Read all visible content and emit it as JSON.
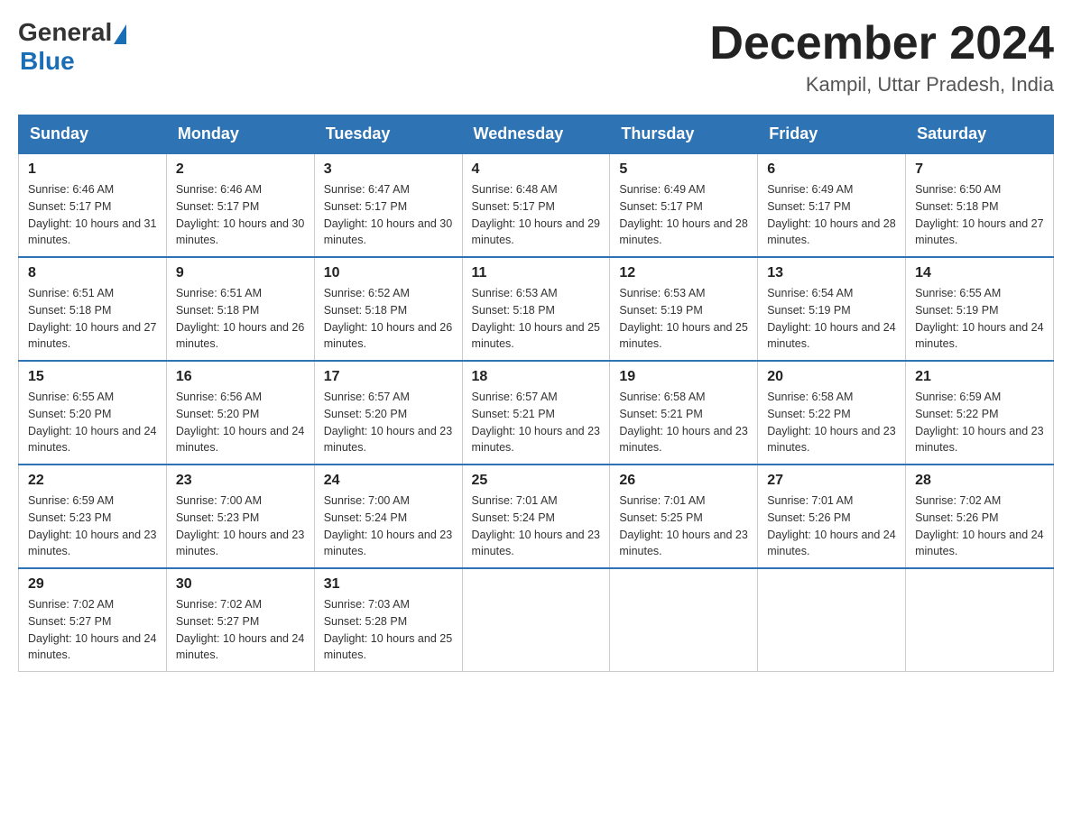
{
  "logo": {
    "general": "General",
    "blue": "Blue",
    "triangle": "▶"
  },
  "title": {
    "month_year": "December 2024",
    "location": "Kampil, Uttar Pradesh, India"
  },
  "weekdays": [
    "Sunday",
    "Monday",
    "Tuesday",
    "Wednesday",
    "Thursday",
    "Friday",
    "Saturday"
  ],
  "weeks": [
    [
      {
        "day": "1",
        "sunrise": "6:46 AM",
        "sunset": "5:17 PM",
        "daylight": "10 hours and 31 minutes."
      },
      {
        "day": "2",
        "sunrise": "6:46 AM",
        "sunset": "5:17 PM",
        "daylight": "10 hours and 30 minutes."
      },
      {
        "day": "3",
        "sunrise": "6:47 AM",
        "sunset": "5:17 PM",
        "daylight": "10 hours and 30 minutes."
      },
      {
        "day": "4",
        "sunrise": "6:48 AM",
        "sunset": "5:17 PM",
        "daylight": "10 hours and 29 minutes."
      },
      {
        "day": "5",
        "sunrise": "6:49 AM",
        "sunset": "5:17 PM",
        "daylight": "10 hours and 28 minutes."
      },
      {
        "day": "6",
        "sunrise": "6:49 AM",
        "sunset": "5:17 PM",
        "daylight": "10 hours and 28 minutes."
      },
      {
        "day": "7",
        "sunrise": "6:50 AM",
        "sunset": "5:18 PM",
        "daylight": "10 hours and 27 minutes."
      }
    ],
    [
      {
        "day": "8",
        "sunrise": "6:51 AM",
        "sunset": "5:18 PM",
        "daylight": "10 hours and 27 minutes."
      },
      {
        "day": "9",
        "sunrise": "6:51 AM",
        "sunset": "5:18 PM",
        "daylight": "10 hours and 26 minutes."
      },
      {
        "day": "10",
        "sunrise": "6:52 AM",
        "sunset": "5:18 PM",
        "daylight": "10 hours and 26 minutes."
      },
      {
        "day": "11",
        "sunrise": "6:53 AM",
        "sunset": "5:18 PM",
        "daylight": "10 hours and 25 minutes."
      },
      {
        "day": "12",
        "sunrise": "6:53 AM",
        "sunset": "5:19 PM",
        "daylight": "10 hours and 25 minutes."
      },
      {
        "day": "13",
        "sunrise": "6:54 AM",
        "sunset": "5:19 PM",
        "daylight": "10 hours and 24 minutes."
      },
      {
        "day": "14",
        "sunrise": "6:55 AM",
        "sunset": "5:19 PM",
        "daylight": "10 hours and 24 minutes."
      }
    ],
    [
      {
        "day": "15",
        "sunrise": "6:55 AM",
        "sunset": "5:20 PM",
        "daylight": "10 hours and 24 minutes."
      },
      {
        "day": "16",
        "sunrise": "6:56 AM",
        "sunset": "5:20 PM",
        "daylight": "10 hours and 24 minutes."
      },
      {
        "day": "17",
        "sunrise": "6:57 AM",
        "sunset": "5:20 PM",
        "daylight": "10 hours and 23 minutes."
      },
      {
        "day": "18",
        "sunrise": "6:57 AM",
        "sunset": "5:21 PM",
        "daylight": "10 hours and 23 minutes."
      },
      {
        "day": "19",
        "sunrise": "6:58 AM",
        "sunset": "5:21 PM",
        "daylight": "10 hours and 23 minutes."
      },
      {
        "day": "20",
        "sunrise": "6:58 AM",
        "sunset": "5:22 PM",
        "daylight": "10 hours and 23 minutes."
      },
      {
        "day": "21",
        "sunrise": "6:59 AM",
        "sunset": "5:22 PM",
        "daylight": "10 hours and 23 minutes."
      }
    ],
    [
      {
        "day": "22",
        "sunrise": "6:59 AM",
        "sunset": "5:23 PM",
        "daylight": "10 hours and 23 minutes."
      },
      {
        "day": "23",
        "sunrise": "7:00 AM",
        "sunset": "5:23 PM",
        "daylight": "10 hours and 23 minutes."
      },
      {
        "day": "24",
        "sunrise": "7:00 AM",
        "sunset": "5:24 PM",
        "daylight": "10 hours and 23 minutes."
      },
      {
        "day": "25",
        "sunrise": "7:01 AM",
        "sunset": "5:24 PM",
        "daylight": "10 hours and 23 minutes."
      },
      {
        "day": "26",
        "sunrise": "7:01 AM",
        "sunset": "5:25 PM",
        "daylight": "10 hours and 23 minutes."
      },
      {
        "day": "27",
        "sunrise": "7:01 AM",
        "sunset": "5:26 PM",
        "daylight": "10 hours and 24 minutes."
      },
      {
        "day": "28",
        "sunrise": "7:02 AM",
        "sunset": "5:26 PM",
        "daylight": "10 hours and 24 minutes."
      }
    ],
    [
      {
        "day": "29",
        "sunrise": "7:02 AM",
        "sunset": "5:27 PM",
        "daylight": "10 hours and 24 minutes."
      },
      {
        "day": "30",
        "sunrise": "7:02 AM",
        "sunset": "5:27 PM",
        "daylight": "10 hours and 24 minutes."
      },
      {
        "day": "31",
        "sunrise": "7:03 AM",
        "sunset": "5:28 PM",
        "daylight": "10 hours and 25 minutes."
      },
      null,
      null,
      null,
      null
    ]
  ],
  "labels": {
    "sunrise": "Sunrise: ",
    "sunset": "Sunset: ",
    "daylight": "Daylight: "
  }
}
